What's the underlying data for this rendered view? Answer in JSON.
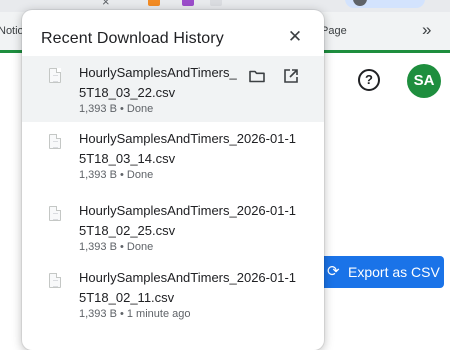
{
  "browser": {
    "bookmarks_left": "Notio",
    "bookmarks_right": "Page",
    "bookmarks_more": "»",
    "tab_close_mark": "×"
  },
  "page": {
    "help_icon_label": "?",
    "avatar_initials": "SA",
    "export_button_label": "Export as CSV",
    "export_icon": "⟳",
    "accent_color": "#1e8e3e",
    "button_color": "#1a73e8"
  },
  "popup": {
    "title": "Recent Download History",
    "close_glyph": "✕",
    "items": [
      {
        "name": "HourlySamplesAndTimers_​5T18_03_22.csv",
        "meta": "1,393 B • Done"
      },
      {
        "name": "HourlySamplesAndTimers_2026-01-15T18_03_14.csv",
        "meta": "1,393 B • Done"
      },
      {
        "name": "HourlySamplesAndTimers_2026-01-15T18_02_25.csv",
        "meta": "1,393 B • Done"
      },
      {
        "name": "HourlySamplesAndTimers_2026-01-15T18_02_11.csv",
        "meta": "1,393 B • 1 minute ago"
      }
    ]
  }
}
